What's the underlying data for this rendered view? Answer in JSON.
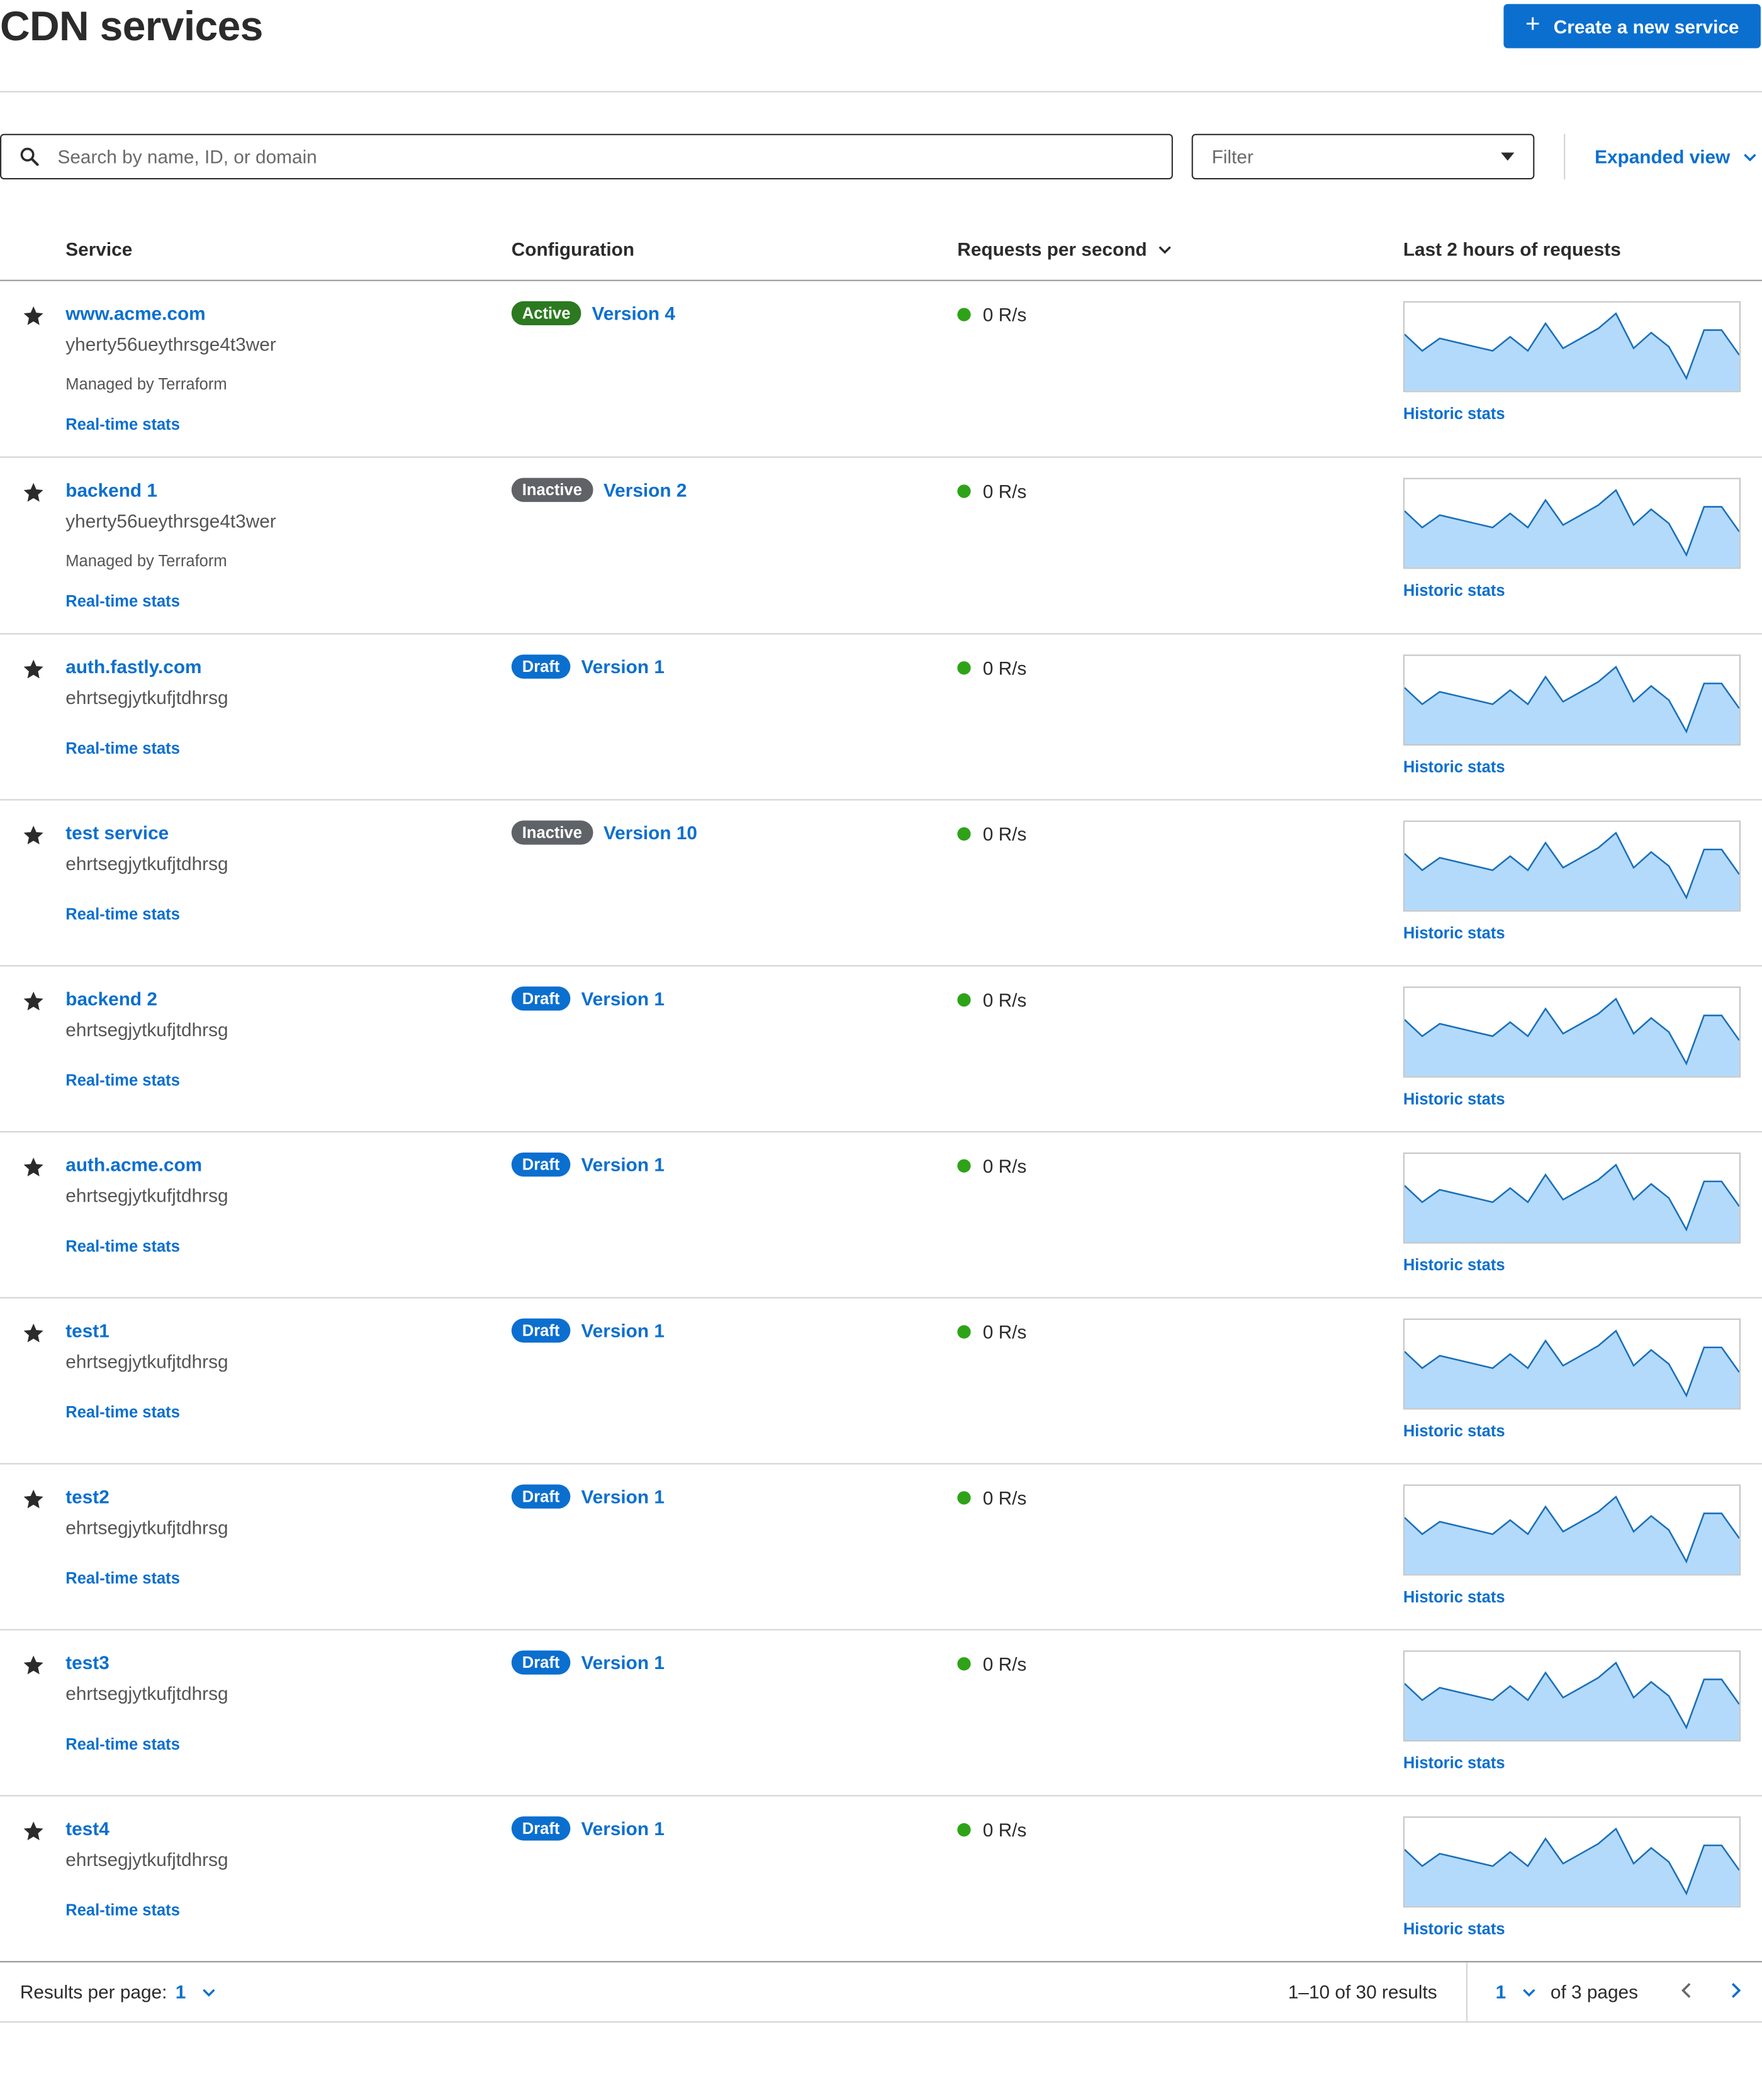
{
  "header": {
    "title": "CDN services",
    "create_button": {
      "label": "Create a new service",
      "icon": "plus-icon"
    }
  },
  "toolbar": {
    "search": {
      "placeholder": "Search by name, ID, or domain",
      "value": "",
      "icon": "search-icon"
    },
    "filter": {
      "placeholder": "Filter",
      "icon": "caret-down-icon"
    },
    "view_toggle": {
      "label": "Expanded view",
      "icon": "chevron-down-icon"
    }
  },
  "table": {
    "columns": [
      "Service",
      "Configuration",
      "Requests per second",
      "Last 2 hours of requests"
    ],
    "sorted_column": "Requests per second",
    "rows": [
      {
        "name": "www.acme.com",
        "id": "yherty56ueythrsge4t3wer",
        "managed": "Managed by Terraform",
        "status": "Active",
        "version": "Version 4",
        "rps": "0 R/s",
        "realtime_label": "Real-time stats",
        "historic_label": "Historic stats"
      },
      {
        "name": "backend 1",
        "id": "yherty56ueythrsge4t3wer",
        "managed": "Managed by Terraform",
        "status": "Inactive",
        "version": "Version 2",
        "rps": "0 R/s",
        "realtime_label": "Real-time stats",
        "historic_label": "Historic stats"
      },
      {
        "name": "auth.fastly.com",
        "id": "ehrtsegjytkufjtdhrsg",
        "managed": "",
        "status": "Draft",
        "version": "Version 1",
        "rps": "0 R/s",
        "realtime_label": "Real-time stats",
        "historic_label": "Historic stats"
      },
      {
        "name": "test service",
        "id": "ehrtsegjytkufjtdhrsg",
        "managed": "",
        "status": "Inactive",
        "version": "Version 10",
        "rps": "0 R/s",
        "realtime_label": "Real-time stats",
        "historic_label": "Historic stats"
      },
      {
        "name": "backend 2",
        "id": "ehrtsegjytkufjtdhrsg",
        "managed": "",
        "status": "Draft",
        "version": "Version 1",
        "rps": "0 R/s",
        "realtime_label": "Real-time stats",
        "historic_label": "Historic stats"
      },
      {
        "name": "auth.acme.com",
        "id": "ehrtsegjytkufjtdhrsg",
        "managed": "",
        "status": "Draft",
        "version": "Version 1",
        "rps": "0 R/s",
        "realtime_label": "Real-time stats",
        "historic_label": "Historic stats"
      },
      {
        "name": "test1",
        "id": "ehrtsegjytkufjtdhrsg",
        "managed": "",
        "status": "Draft",
        "version": "Version 1",
        "rps": "0 R/s",
        "realtime_label": "Real-time stats",
        "historic_label": "Historic stats"
      },
      {
        "name": "test2",
        "id": "ehrtsegjytkufjtdhrsg",
        "managed": "",
        "status": "Draft",
        "version": "Version 1",
        "rps": "0 R/s",
        "realtime_label": "Real-time stats",
        "historic_label": "Historic stats"
      },
      {
        "name": "test3",
        "id": "ehrtsegjytkufjtdhrsg",
        "managed": "",
        "status": "Draft",
        "version": "Version 1",
        "rps": "0 R/s",
        "realtime_label": "Real-time stats",
        "historic_label": "Historic stats"
      },
      {
        "name": "test4",
        "id": "ehrtsegjytkufjtdhrsg",
        "managed": "",
        "status": "Draft",
        "version": "Version 1",
        "rps": "0 R/s",
        "realtime_label": "Real-time stats",
        "historic_label": "Historic stats"
      }
    ],
    "sparkline_shape": [
      0.35,
      0.55,
      0.4,
      0.45,
      0.5,
      0.55,
      0.38,
      0.55,
      0.22,
      0.52,
      0.4,
      0.28,
      0.1,
      0.52,
      0.33,
      0.5,
      0.88,
      0.3,
      0.3,
      0.6
    ]
  },
  "colors": {
    "accent": "#0b6fcf",
    "active_badge": "#2b7a1f",
    "inactive_badge": "#5f6368",
    "draft_badge": "#0b6fcf",
    "status_dot": "#2ea318",
    "sparkline_fill": "#b3dafb",
    "sparkline_line": "#1a6fb8"
  },
  "pagination": {
    "results_per_page_label": "Results per page:",
    "results_per_page_value": "1",
    "results_text": "1–10 of 30 results",
    "current_page": "1",
    "of_pages": "of 3 pages"
  }
}
